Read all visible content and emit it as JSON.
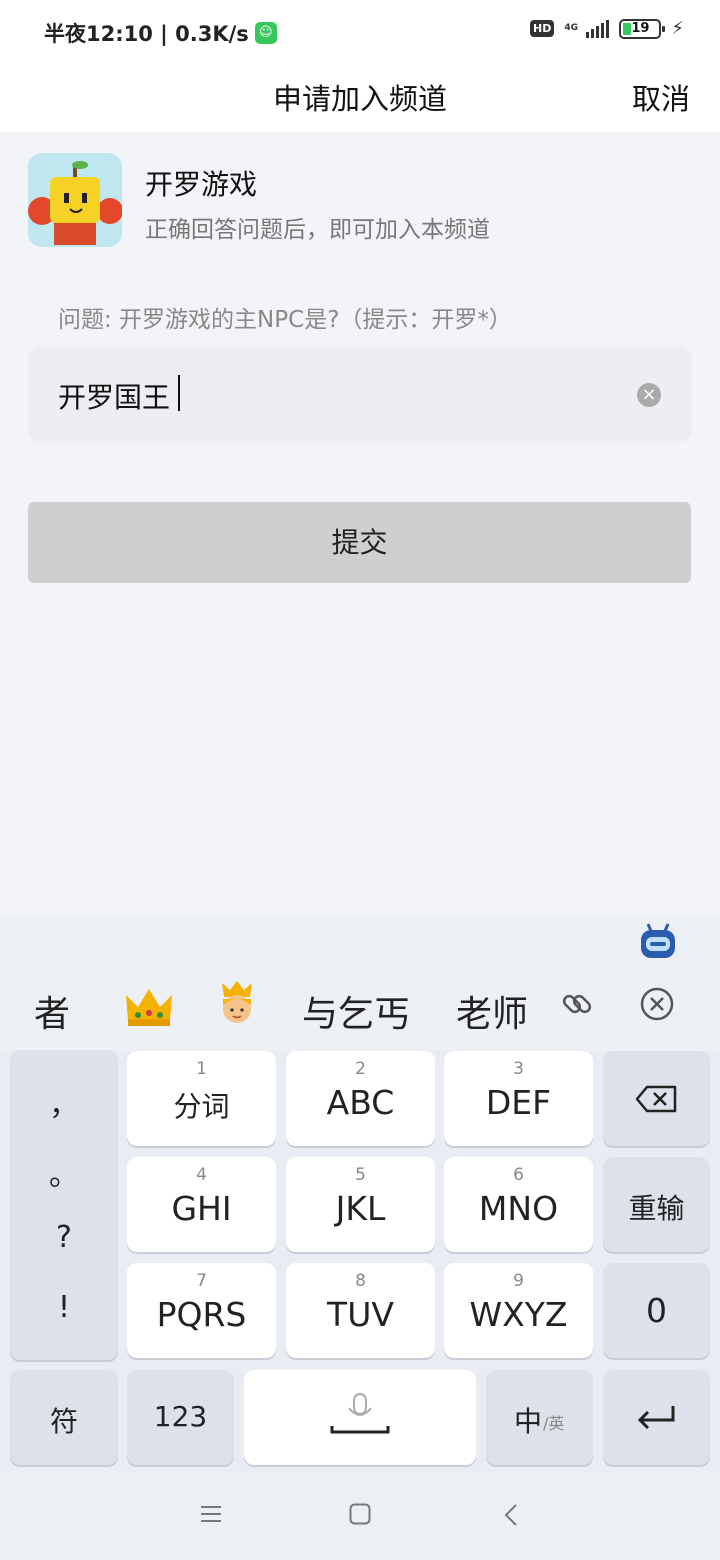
{
  "status_bar": {
    "time_speed": "半夜12:10 | 0.3K/s",
    "network": "4G",
    "battery": "19"
  },
  "header": {
    "title": "申请加入频道",
    "cancel_label": "取消"
  },
  "channel": {
    "name": "开罗游戏",
    "description": "正确回答问题后，即可加入本频道"
  },
  "question": "问题: 开罗游戏的主NPC是?（提示：开罗*）",
  "answer": {
    "value": "开罗国王"
  },
  "submit_label": "提交",
  "keyboard": {
    "candidates": [
      "者",
      "与乞丐",
      "老师"
    ],
    "candidate_emojis": [
      "crown-emoji",
      "prince-emoji"
    ],
    "keys": {
      "k1": {
        "num": "1",
        "label": "分词"
      },
      "k2": {
        "num": "2",
        "label": "ABC"
      },
      "k3": {
        "num": "3",
        "label": "DEF"
      },
      "k4": {
        "num": "4",
        "label": "GHI"
      },
      "k5": {
        "num": "5",
        "label": "JKL"
      },
      "k6": {
        "num": "6",
        "label": "MNO"
      },
      "k7": {
        "num": "7",
        "label": "PQRS"
      },
      "k8": {
        "num": "8",
        "label": "TUV"
      },
      "k9": {
        "num": "9",
        "label": "WXYZ"
      },
      "reenter": "重输",
      "zero": "0",
      "symbols": "符",
      "numbers": "123",
      "lang_main": "中",
      "lang_sub": "/英"
    },
    "punctuation": [
      "，",
      "。",
      "?",
      "!"
    ]
  }
}
